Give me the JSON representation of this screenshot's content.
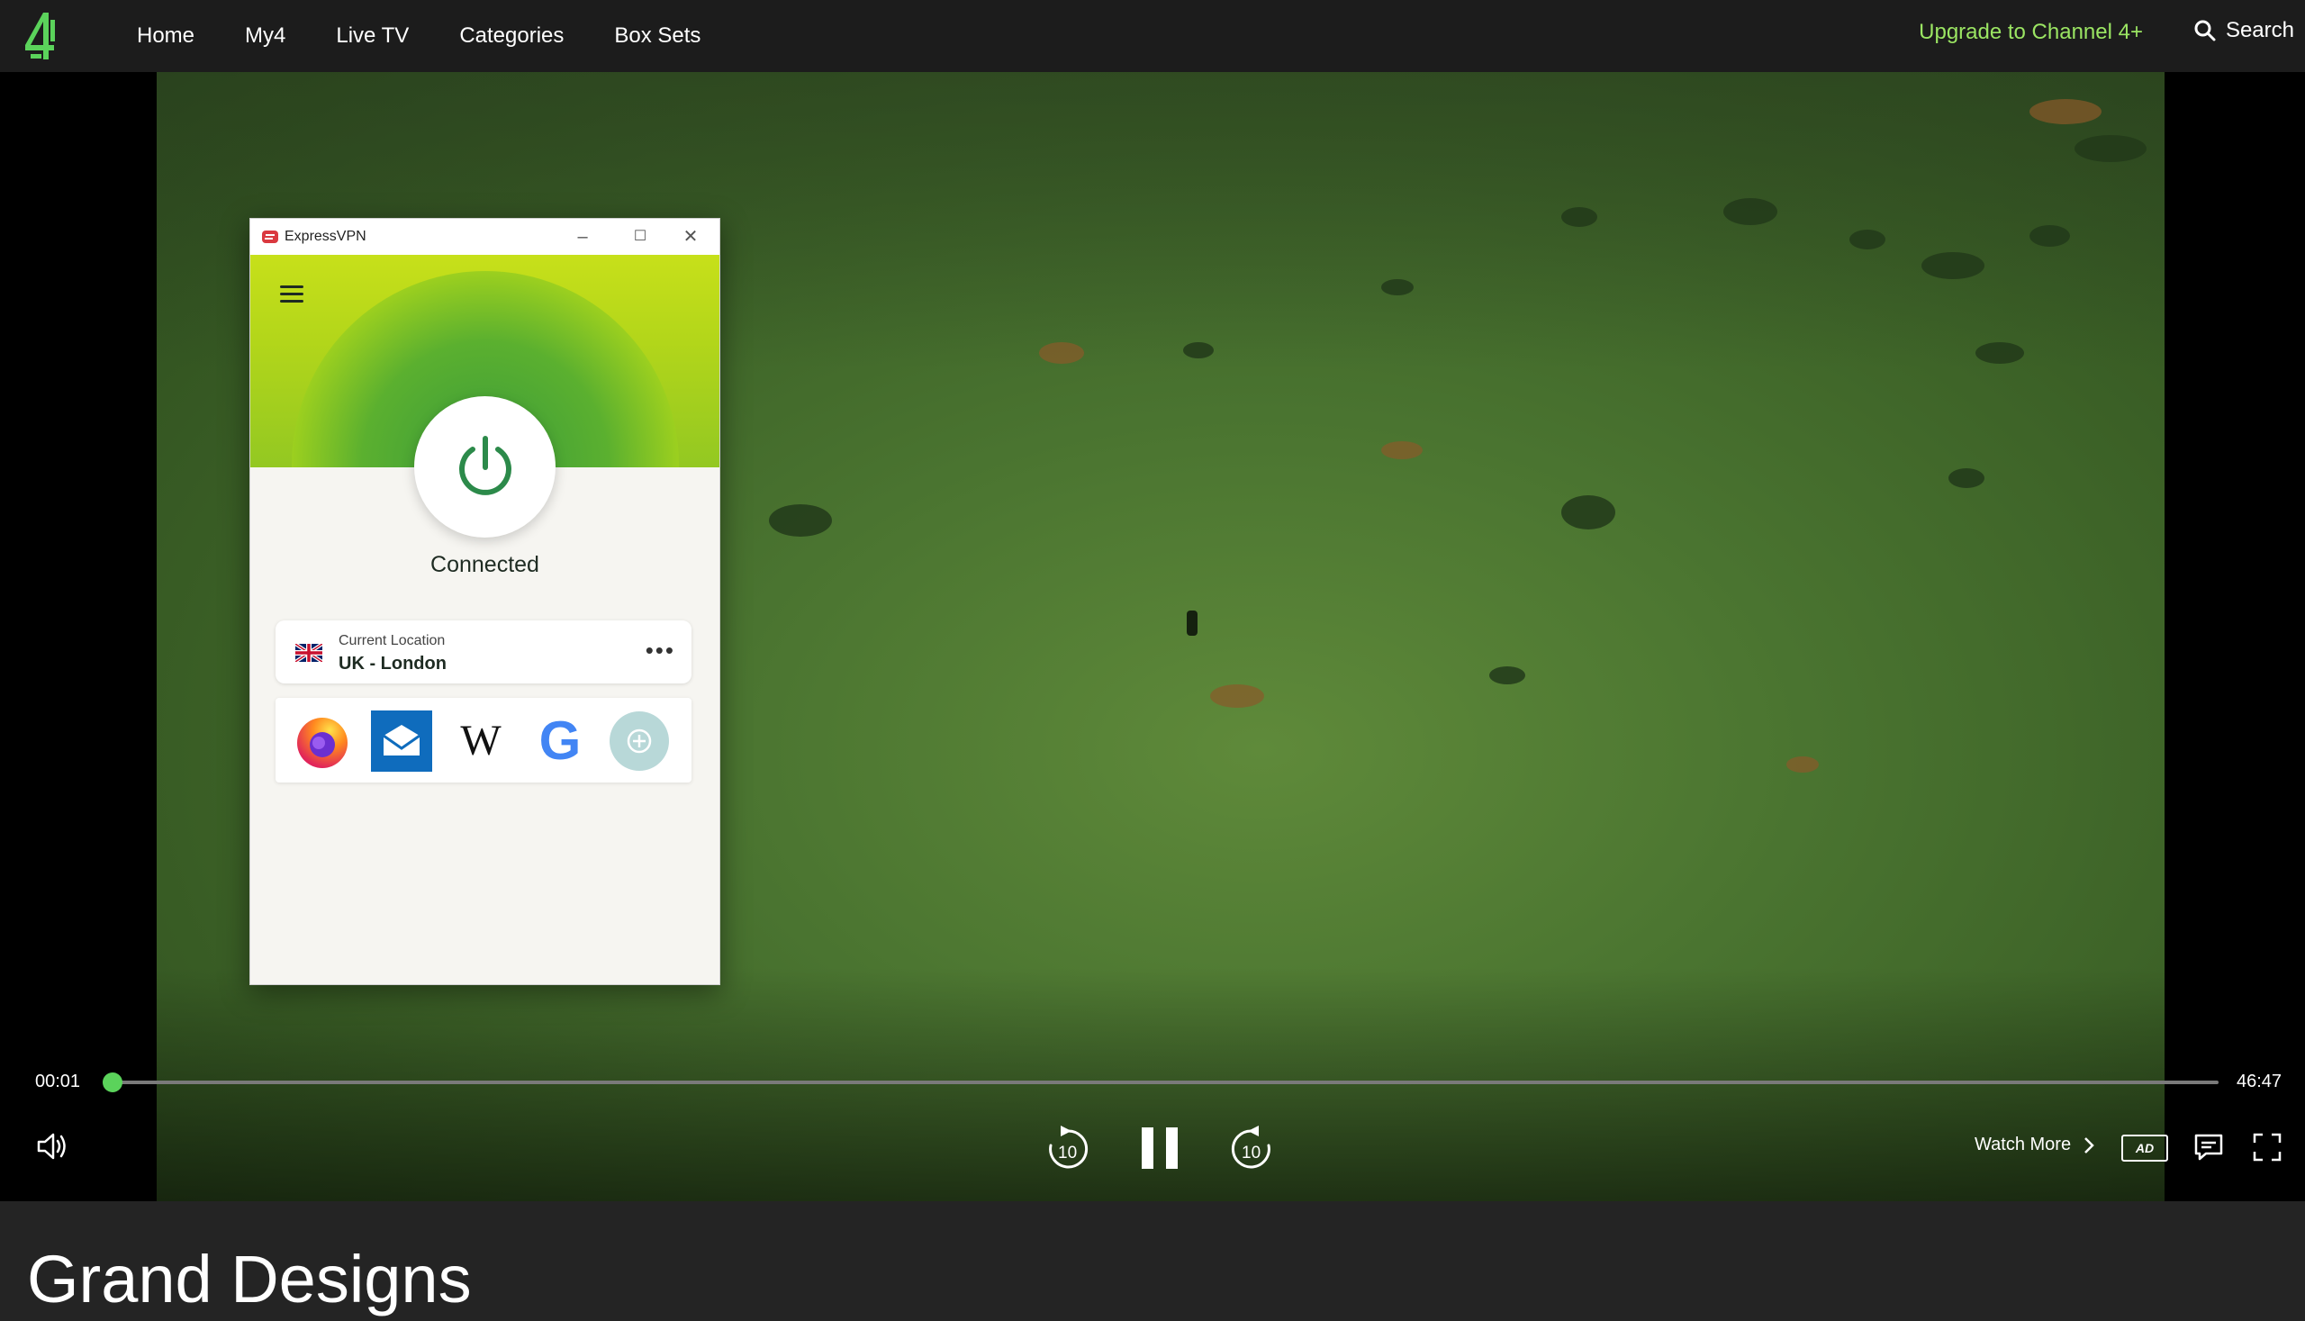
{
  "nav": {
    "items": [
      {
        "label": "Home"
      },
      {
        "label": "My4"
      },
      {
        "label": "Live TV"
      },
      {
        "label": "Categories"
      },
      {
        "label": "Box Sets"
      }
    ],
    "upgrade_label": "Upgrade to Channel 4+",
    "search_label": "Search",
    "logo_icon": "channel4-logo-icon",
    "accent_color": "#9be563"
  },
  "vpn": {
    "title": "ExpressVPN",
    "status": "Connected",
    "location_label": "Current Location",
    "location_value": "UK - London",
    "more_label": "•••",
    "shortcuts": [
      {
        "icon": "firefox-icon"
      },
      {
        "icon": "mail-icon"
      },
      {
        "icon": "wikipedia-icon",
        "glyph": "W"
      },
      {
        "icon": "google-icon",
        "glyph": "G"
      },
      {
        "icon": "add-shortcut-icon"
      }
    ]
  },
  "player": {
    "current_time": "00:01",
    "duration": "46:47",
    "progress": 0.0004,
    "skip_back_label": "10",
    "skip_forward_label": "10",
    "watch_more_label": "Watch More",
    "ad_label": "AD",
    "progress_color": "#5bd35b"
  },
  "show": {
    "title": "Grand Designs"
  }
}
